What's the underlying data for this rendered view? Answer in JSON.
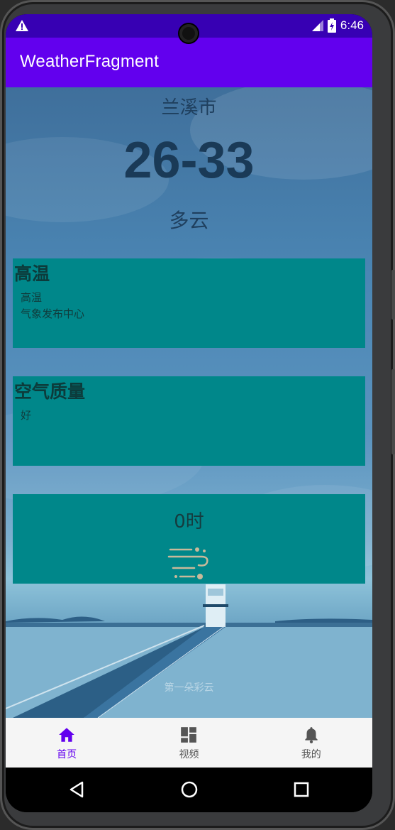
{
  "status_bar": {
    "time": "6:46",
    "warning_icon": "warning-icon",
    "signal_icon": "signal-icon",
    "battery_icon": "battery-charging-icon"
  },
  "app_bar": {
    "title": "WeatherFragment"
  },
  "weather": {
    "city": "兰溪市",
    "temperature": "26-33",
    "condition": "多云"
  },
  "cards": {
    "alert": {
      "title": "高温",
      "line1": "高温",
      "line2": "气象发布中心"
    },
    "air_quality": {
      "title": "空气质量",
      "line1": "好"
    },
    "hourly": {
      "hour": "0时",
      "icon": "wind-icon"
    }
  },
  "background": {
    "watermark": "第一朵彩云"
  },
  "bottom_nav": {
    "items": [
      {
        "label": "首页",
        "icon": "home-icon",
        "active": true
      },
      {
        "label": "视频",
        "icon": "dashboard-icon",
        "active": false
      },
      {
        "label": "我的",
        "icon": "bell-icon",
        "active": false
      }
    ]
  },
  "colors": {
    "primary": "#6200ee",
    "primary_dark": "#3700b3",
    "card": "#00878a"
  }
}
